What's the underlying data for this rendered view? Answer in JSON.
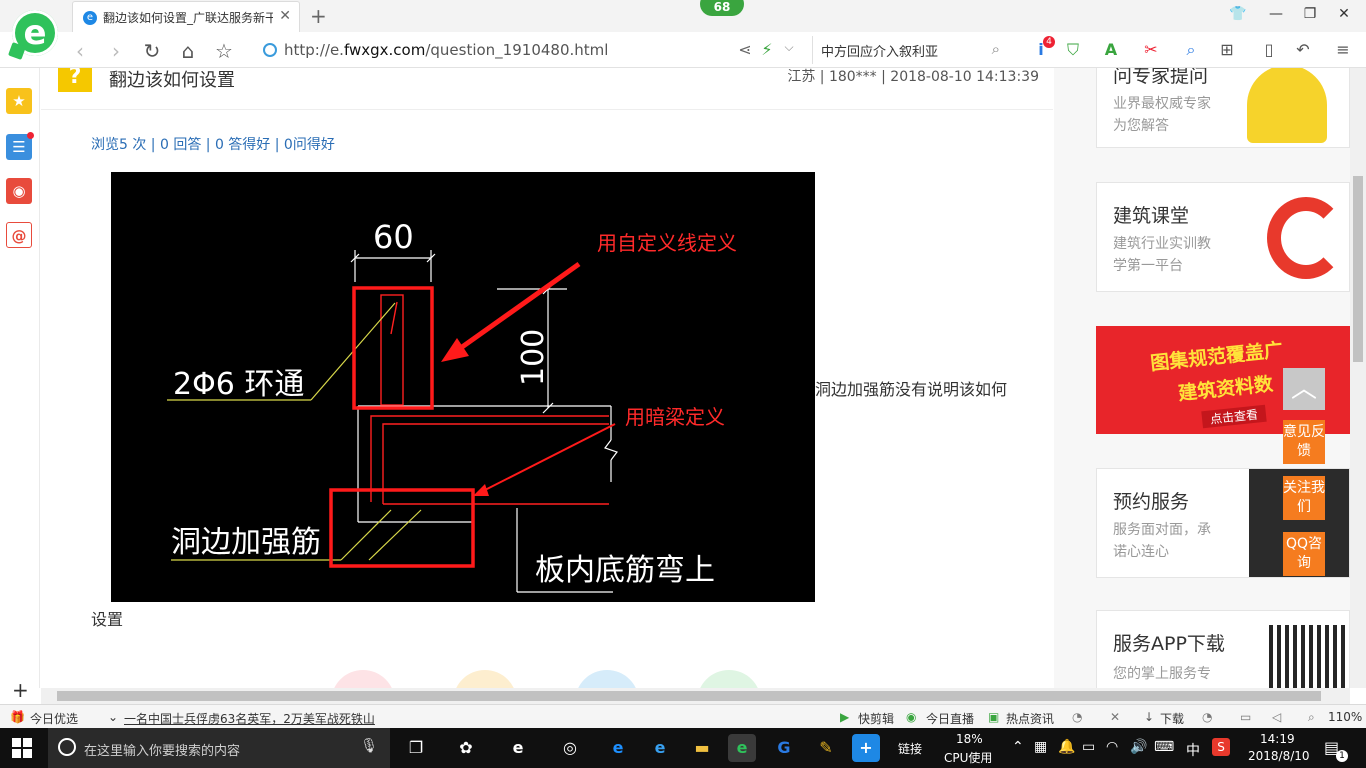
{
  "browser": {
    "tab_title": "翻边该如何设置_广联达服务新干线",
    "badge_count": "68",
    "url_scheme": "http://e.",
    "url_domain": "fwxgx.com",
    "url_path": "/question_1910480.html",
    "search_text": "中方回应介入叙利亚",
    "ext_badge": "4"
  },
  "question": {
    "title": "翻边该如何设置",
    "meta": "江苏 | 180*** | 2018-08-10 14:13:39",
    "stats": "浏览5 次 | 0 回答 | 0 答得好 | 0问得好",
    "body_right": "洞边加强筋没有说明该如何",
    "body_bottom": "设置"
  },
  "figure": {
    "dim_width": "60",
    "dim_height": "100",
    "label_rebar": "2Φ6 环通",
    "label_hole": "洞边加强筋",
    "label_slab": "板内底筋弯上",
    "note_custom_line": "用自定义线定义",
    "note_hidden_beam": "用暗梁定义",
    "colors": {
      "annotation": "#ff1a1a",
      "rebar": "#ff2020",
      "leader": "#d8d84a",
      "line": "#ffffff"
    }
  },
  "sidebar_right": {
    "cards": [
      {
        "title": "问专家提问",
        "sub1": "业界最权威专家",
        "sub2": "为您解答"
      },
      {
        "title": "建筑课堂",
        "sub1": "建筑行业实训教",
        "sub2": "学第一平台"
      },
      {
        "title": "预约服务",
        "sub1": "服务面对面，承",
        "sub2": "诺心连心"
      },
      {
        "title": "服务APP下载",
        "sub1": "您的掌上服务专",
        "sub2": ""
      }
    ],
    "ad_line1": "图集规范覆盖广",
    "ad_line2": "建筑资料数",
    "ad_line3": "点击查看",
    "float_feedback": "意见反馈",
    "float_follow": "关注我们",
    "float_qq": "QQ咨询"
  },
  "statusbar": {
    "today_pick": "今日优选",
    "news": "一名中国士兵俘虏63名英军，2万美军战死铁山",
    "quick_clip": "快剪辑",
    "live": "今日直播",
    "hot": "热点资讯",
    "download": "下载",
    "zoom": "110%"
  },
  "taskbar": {
    "search_placeholder": "在这里输入你要搜索的内容",
    "link_label": "链接",
    "cpu_percent": "18%",
    "cpu_label": "CPU使用",
    "ime": "中",
    "time": "14:19",
    "date": "2018/8/10",
    "notif_count": "1"
  }
}
